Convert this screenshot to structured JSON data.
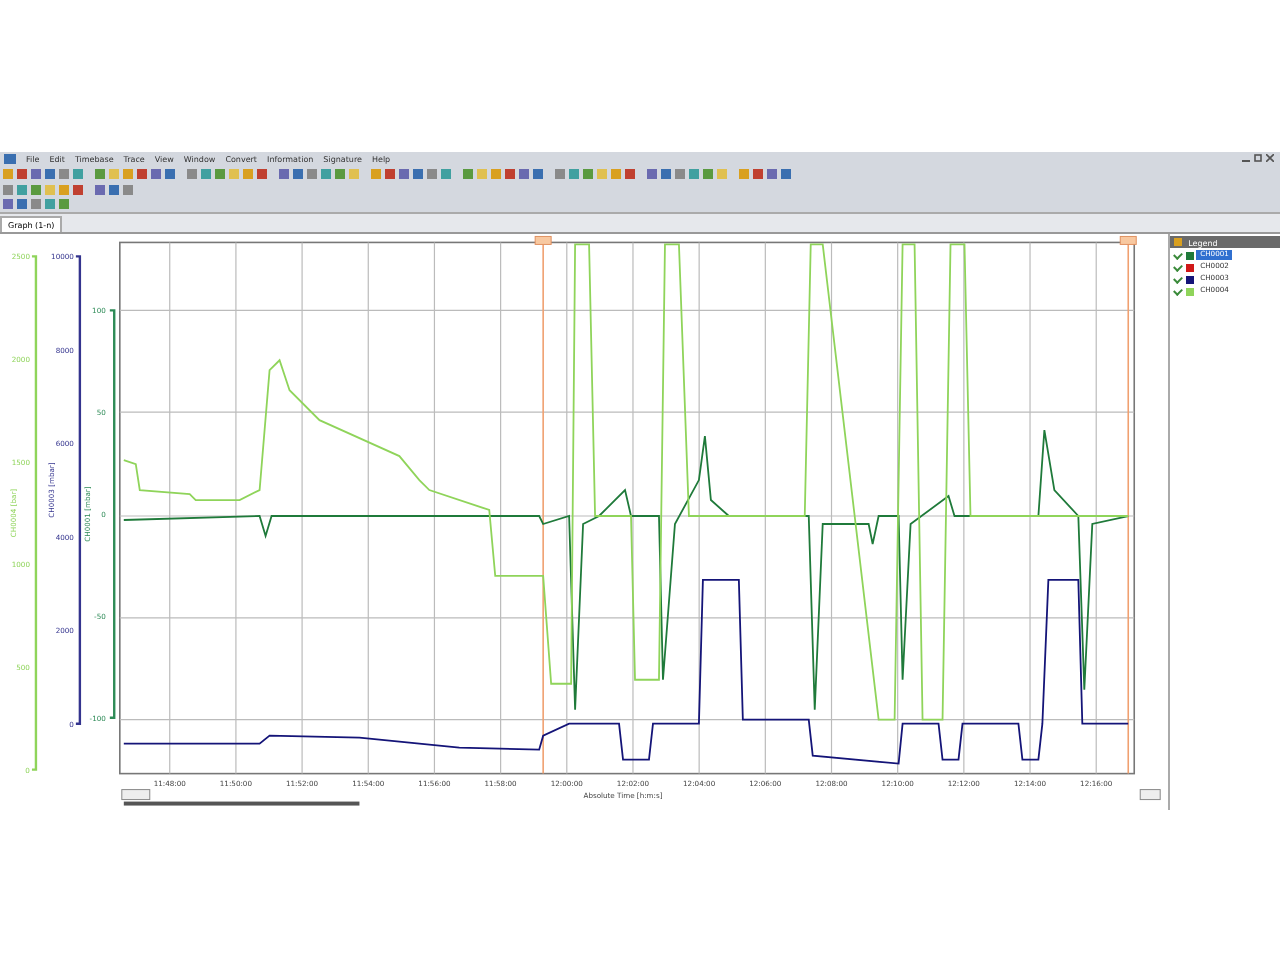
{
  "menu": [
    {
      "label": "File"
    },
    {
      "label": "Edit"
    },
    {
      "label": "Timebase"
    },
    {
      "label": "Trace"
    },
    {
      "label": "View"
    },
    {
      "label": "Window"
    },
    {
      "label": "Convert"
    },
    {
      "label": "Information"
    },
    {
      "label": "Signature"
    },
    {
      "label": "Help"
    }
  ],
  "tab": {
    "label": "Graph (1-n)",
    "selected": true
  },
  "plot": {
    "x_title": "Absolute Time [h:m:s]",
    "x_ticks": [
      "11:48:00",
      "11:50:00",
      "11:52:00",
      "11:54:00",
      "11:56:00",
      "11:58:00",
      "12:00:00",
      "12:02:00",
      "12:04:00",
      "12:06:00",
      "12:08:00",
      "12:10:00",
      "12:12:00",
      "12:14:00",
      "12:16:00"
    ],
    "axes": [
      {
        "title": "CH0004 [bar]",
        "color": "#8fd45a",
        "ticks": [
          "2500",
          "2000",
          "1500",
          "1000",
          "500",
          "0"
        ]
      },
      {
        "title": "CH0003 [mbar]",
        "color": "#34348e",
        "ticks": [
          "10000",
          "8000",
          "6000",
          "4000",
          "2000",
          "0"
        ]
      },
      {
        "title": "CH0001 [mbar]",
        "color": "#2e8b57",
        "ticks": [
          "100",
          "50",
          "0",
          "-50",
          "-100"
        ]
      }
    ]
  },
  "legend": {
    "title": "Legend",
    "items": [
      {
        "label": "CH0001",
        "color": "#1f7a3a",
        "checked": true,
        "selected": true
      },
      {
        "label": "CH0002",
        "color": "#d01818",
        "checked": true,
        "selected": false
      },
      {
        "label": "CH0003",
        "color": "#141478",
        "checked": true,
        "selected": false
      },
      {
        "label": "CH0004",
        "color": "#8fd45a",
        "checked": true,
        "selected": false
      }
    ]
  }
}
